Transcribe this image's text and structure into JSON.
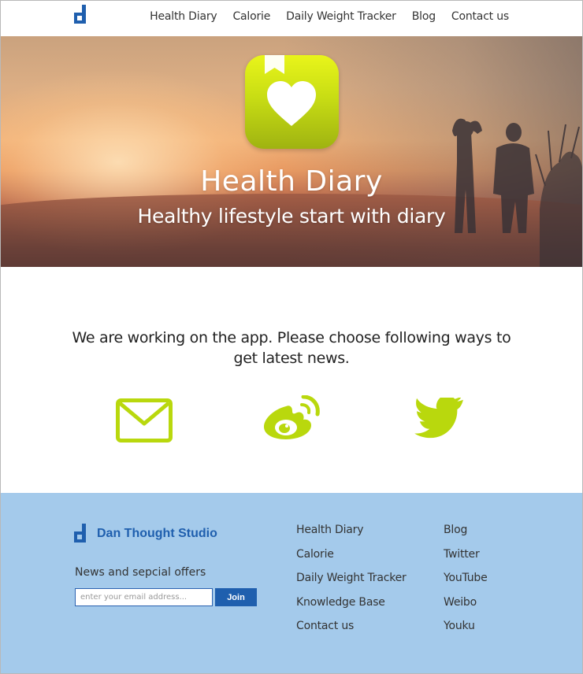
{
  "nav": {
    "logo_icon": "d-logo-icon",
    "links": [
      "Health Diary",
      "Calorie",
      "Daily Weight Tracker",
      "Blog",
      "Contact us"
    ]
  },
  "hero": {
    "app_icon": "heart-bookmark-icon",
    "title": "Health Diary",
    "subtitle": "Healthy lifestyle start with diary"
  },
  "main": {
    "message": "We are working on the app. Please choose following ways to get latest news.",
    "social": [
      "mail-icon",
      "weibo-icon",
      "twitter-icon"
    ]
  },
  "footer": {
    "brand_name": "Dan Thought Studio",
    "news_label": "News and sepcial offers",
    "email_placeholder": "enter your email address...",
    "join_label": "Join",
    "links_col1": [
      "Health Diary",
      "Calorie",
      "Daily Weight Tracker",
      "Knowledge Base",
      "Contact us"
    ],
    "links_col2": [
      "Blog",
      "Twitter",
      "YouTube",
      "Weibo",
      "Youku"
    ]
  },
  "colors": {
    "accent": "#b9d80d",
    "brand_blue": "#1f5fae",
    "footer_bg": "#a4caeb"
  }
}
